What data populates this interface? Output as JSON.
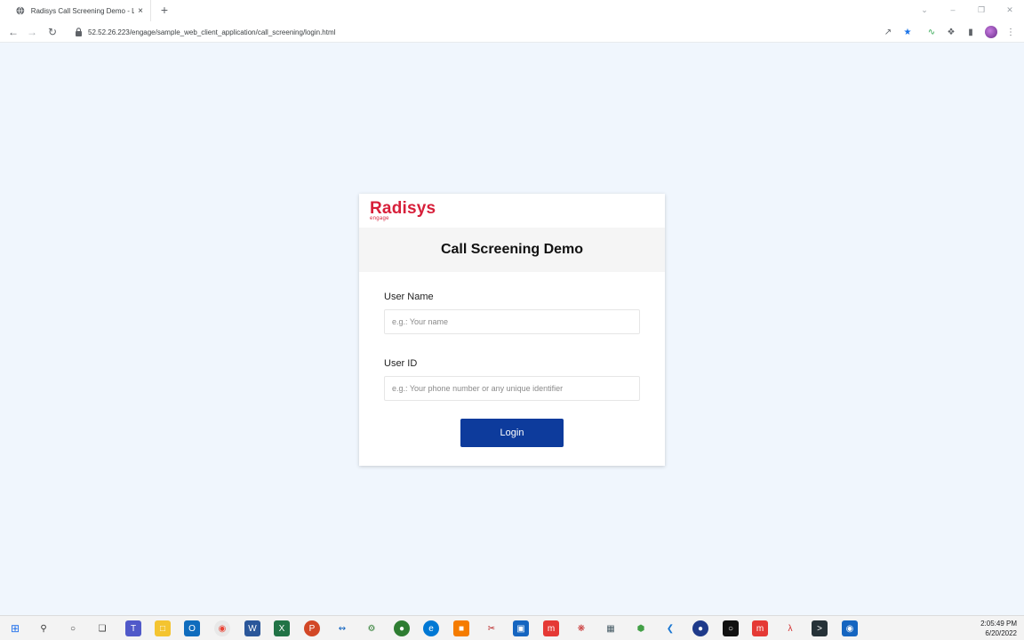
{
  "browser": {
    "tab_title": "Radisys Call Screening Demo - Li",
    "tab_close": "×",
    "new_tab": "+",
    "url": "52.52.26.223/engage/sample_web_client_application/call_screening/login.html",
    "icons": {
      "back": "back-arrow-icon",
      "forward": "forward-arrow-icon",
      "reload": "reload-icon",
      "share": "share-icon",
      "bookmark": "star-icon",
      "extension": "puzzle-icon",
      "menu": "kebab-menu-icon"
    }
  },
  "brand": {
    "logo_text": "Radisys",
    "logo_subtext": "engage",
    "accent_color": "#d71f3a",
    "button_color": "#0d3b9c"
  },
  "login": {
    "title": "Call Screening Demo",
    "username_label": "User Name",
    "username_placeholder": "e.g.: Your name",
    "userid_label": "User ID",
    "userid_placeholder": "e.g.: Your phone number or any unique identifier",
    "button_label": "Login"
  },
  "taskbar": {
    "time": "2:05:49 PM",
    "date": "6/20/2022"
  }
}
